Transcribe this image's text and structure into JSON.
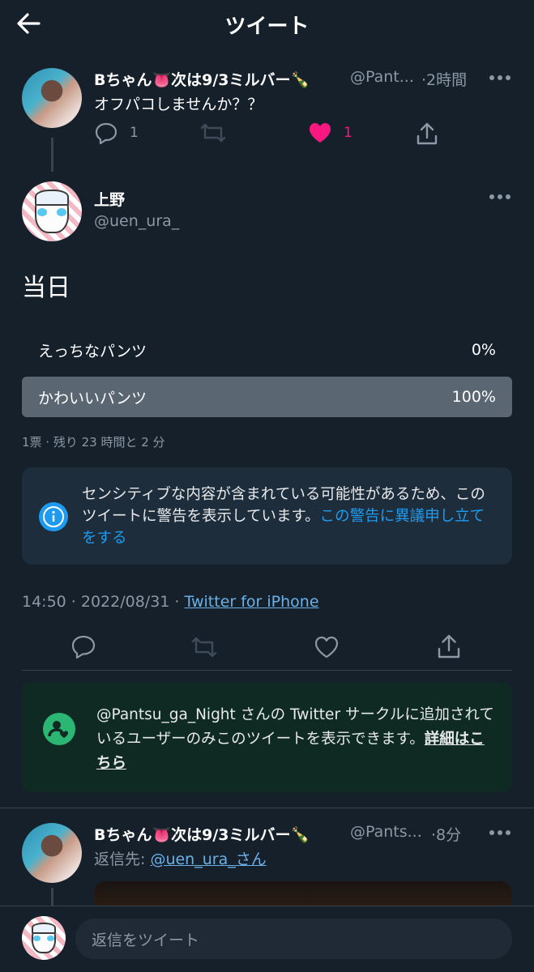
{
  "header": {
    "title": "ツイート"
  },
  "parent_tweet": {
    "author_name": "Bちゃん👅次は9/3ミルバー🍾",
    "handle": "@Pant...",
    "time": "·2時間",
    "text": "オフパコしませんか？？",
    "reply_count": "1",
    "like_count": "1",
    "like_color": "#f91880"
  },
  "main_tweet": {
    "author_name": "上野",
    "handle": "@uen_ura_",
    "text": "当日",
    "poll": {
      "options": [
        {
          "label": "えっちなパンツ",
          "percent": "0%",
          "fraction": 0
        },
        {
          "label": "かわいいパンツ",
          "percent": "100%",
          "fraction": 1
        }
      ],
      "summary": "1票 · 残り 23 時間と 2 分"
    },
    "sensitive_notice": {
      "text": "センシティブな内容が含まれている可能性があるため、このツイートに警告を表示しています。",
      "link": "この警告に異議申し立てをする"
    },
    "timestamp": "14:50 · 2022/08/31 · ",
    "source": "Twitter for iPhone"
  },
  "circle_notice": {
    "text": "@Pantsu_ga_Night さんの Twitter サークルに追加されているユーザーのみこのツイートを表示できます。",
    "link": "詳細はこちら",
    "accent": "#2bb673"
  },
  "reply_tweet": {
    "author_name": "Bちゃん👅次は9/3ミルバー🍾",
    "handle": "@Pants...",
    "time": "·8分",
    "reply_to_label": "返信先: ",
    "reply_to_link": "@uen_ura_さん"
  },
  "composer": {
    "placeholder": "返信をツイート"
  },
  "colors": {
    "background": "#15202b",
    "link": "#1d9bf0",
    "muted": "#8b98a5"
  }
}
